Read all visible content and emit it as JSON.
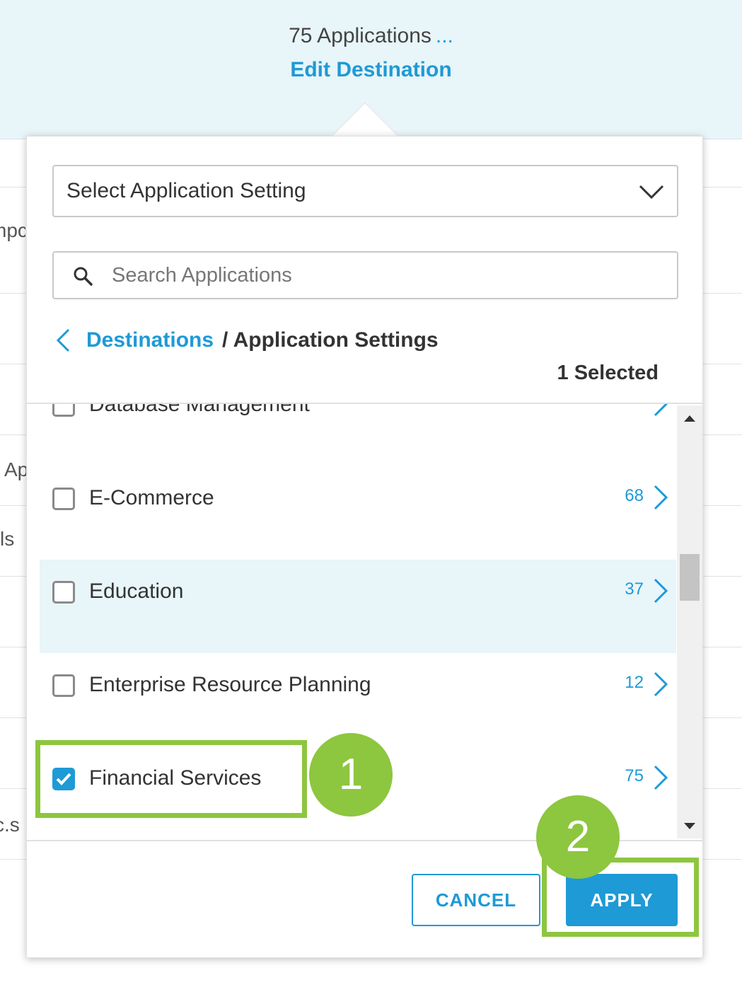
{
  "header": {
    "apps_count": "75 Applications",
    "ellipsis": "...",
    "edit_destination": "Edit Destination"
  },
  "background_fragments": [
    "mpc",
    "Ap",
    "ls",
    "c.s"
  ],
  "select": {
    "label": "Select Application Setting"
  },
  "search": {
    "placeholder": "Search Applications",
    "value": ""
  },
  "breadcrumb": {
    "parent": "Destinations",
    "current": "/ Application Settings"
  },
  "selected_count": "1 Selected",
  "list": {
    "items": [
      {
        "label": "Database Management",
        "count": "",
        "checked": false,
        "partial": true
      },
      {
        "label": "E-Commerce",
        "count": "68",
        "checked": false
      },
      {
        "label": "Education",
        "count": "37",
        "checked": false,
        "highlighted": true
      },
      {
        "label": "Enterprise Resource Planning",
        "count": "12",
        "checked": false
      },
      {
        "label": "Financial Services",
        "count": "75",
        "checked": true
      }
    ]
  },
  "actions": {
    "cancel": "CANCEL",
    "apply": "APPLY"
  },
  "annotations": {
    "step1": "1",
    "step2": "2"
  },
  "colors": {
    "accent": "#1e9ad6",
    "highlight": "#8dc63f",
    "band": "#e8f5f9"
  }
}
